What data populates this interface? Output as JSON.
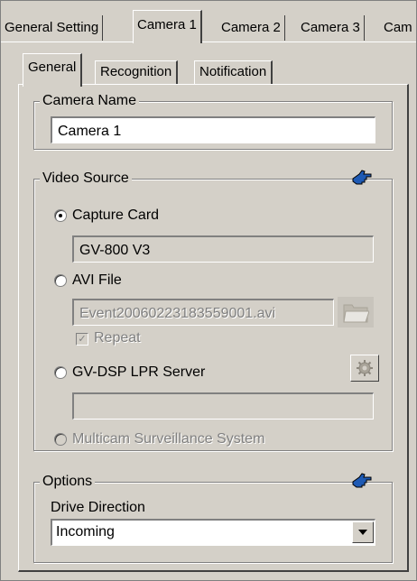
{
  "outer_tabs": [
    "General Setting",
    "Camera 1",
    "Camera 2",
    "Camera 3",
    "Cam"
  ],
  "inner_tabs": [
    "General",
    "Recognition",
    "Notification"
  ],
  "camera_name": {
    "legend": "Camera Name",
    "value": "Camera 1"
  },
  "video_source": {
    "legend": "Video Source",
    "capture_card": {
      "label": "Capture Card",
      "selected": true,
      "device": "GV-800 V3"
    },
    "avi_file": {
      "label": "AVI File",
      "selected": false,
      "file": "Event20060223183559001.avi",
      "repeat_label": "Repeat",
      "repeat_checked": true
    },
    "gv_dsp": {
      "label": "GV-DSP LPR Server",
      "selected": false,
      "server": ""
    },
    "multicam": {
      "label": "Multicam Surveillance System",
      "enabled": false
    }
  },
  "options": {
    "legend": "Options",
    "drive_direction_label": "Drive Direction",
    "drive_direction_value": "Incoming"
  },
  "icons": {
    "pointer": "pointing-hand-icon",
    "folder": "folder-icon",
    "gear": "gear-icon",
    "dropdown": "triangle-down-icon"
  },
  "colors": {
    "accent_blue": "#1e5ab4",
    "face": "#d4d0c8"
  }
}
